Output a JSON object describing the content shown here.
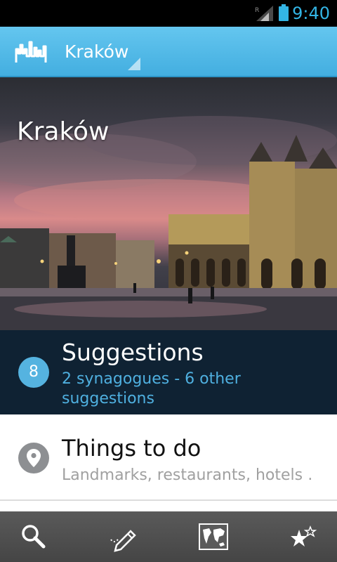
{
  "status_bar": {
    "time": "9:40",
    "icons": [
      "signal-icon",
      "battery-icon"
    ],
    "roaming_indicator": "R",
    "accent_color": "#33b5e5"
  },
  "action_bar": {
    "location": "Kraków",
    "logo_icon": "city-skyline-logo-icon",
    "colors": {
      "bar": "#4fb9e6"
    }
  },
  "hero": {
    "title": "Kraków"
  },
  "sections": {
    "suggestions": {
      "count": "8",
      "title": "Suggestions",
      "subtitle": "2 synagogues - 6 other suggestions",
      "colors": {
        "background": "#0f2233",
        "badge": "#55b3e0",
        "subtitle": "#4fb0e0"
      }
    },
    "things_to_do": {
      "title": "Things to do",
      "subtitle": "Landmarks, restaurants, hotels …",
      "icon": "map-pin-icon"
    }
  },
  "bottom_bar": {
    "buttons": [
      "search-icon",
      "pencil-icon",
      "world-map-icon",
      "favorites-stars-icon"
    ]
  }
}
